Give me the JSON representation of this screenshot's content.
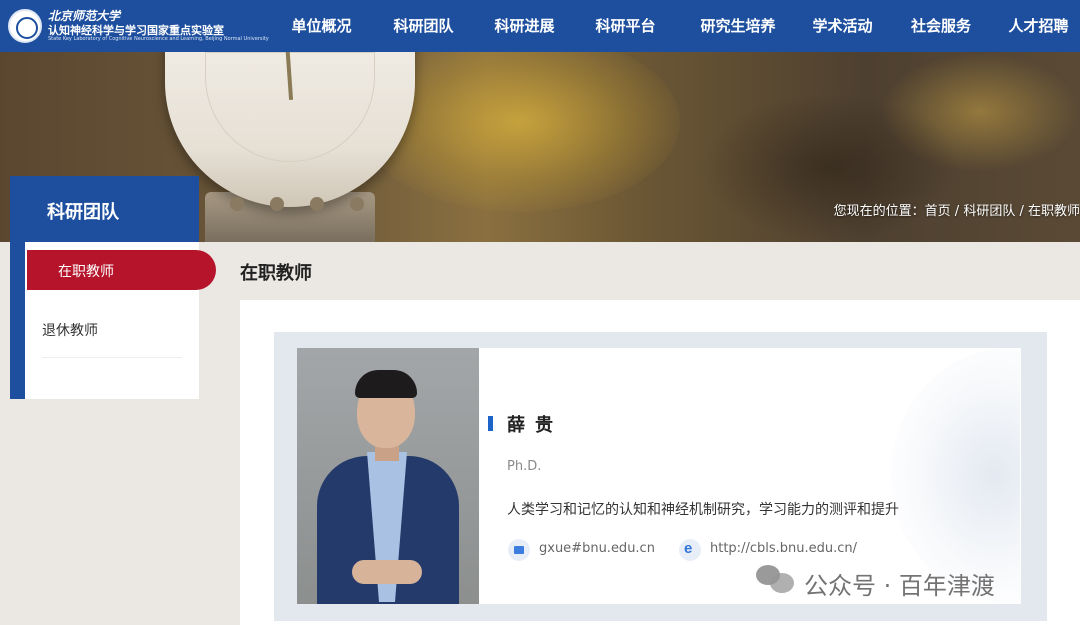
{
  "logo": {
    "line1": "北京师范大学",
    "line2": "认知神经科学与学习国家重点实验室",
    "line3": "State Key Laboratory of Cognitive Neuroscience and Learning, Beijing Normal University"
  },
  "nav": {
    "items": [
      "单位概况",
      "科研团队",
      "科研进展",
      "科研平台",
      "研究生培养",
      "学术活动",
      "社会服务",
      "人才招聘"
    ]
  },
  "breadcrumb": {
    "prefix": "您现在的位置：",
    "home": "首页",
    "sep1": " / ",
    "section": "科研团队",
    "sep2": " / ",
    "current": "在职教师"
  },
  "sidebar": {
    "title": "科研团队",
    "items": [
      {
        "label": "在职教师",
        "active": true
      },
      {
        "label": "退休教师",
        "active": false
      }
    ]
  },
  "main": {
    "section_title": "在职教师"
  },
  "profile": {
    "name": "薛贵",
    "degree": "Ph.D.",
    "research": "人类学习和记忆的认知和神经机制研究，学习能力的测评和提升",
    "email": "gxue#bnu.edu.cn",
    "url": "http://cbls.bnu.edu.cn/"
  },
  "watermark": {
    "text": "公众号 · 百年津渡"
  },
  "icons": {
    "email": "mail-icon",
    "website": "browser-e-icon",
    "wechat": "wechat-icon"
  },
  "colors": {
    "primary_blue": "#1d4f9e",
    "active_red": "#b5142b",
    "accent_blue": "#1d64c8"
  }
}
